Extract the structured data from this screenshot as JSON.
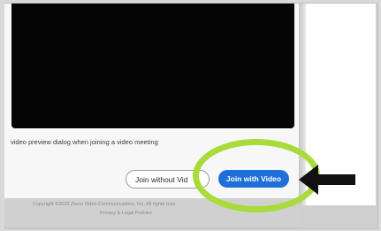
{
  "dialog": {
    "checkbox_label": "video preview dialog when joining a video meeting",
    "join_without_video_label": "Join without Vid",
    "join_with_video_label": "Join with Video"
  },
  "footer": {
    "copyright": "Copyright ©2020 Zoom Video Communications, Inc. All rights rese",
    "privacy_link": "Privacy & Legal Policies"
  },
  "annotations": {
    "highlight_color": "#a8dc3a",
    "arrow_color": "#111111",
    "arrow_icon": "arrow-left-icon"
  },
  "colors": {
    "primary_button": "#1f6fd9",
    "video_preview": "#050505"
  }
}
